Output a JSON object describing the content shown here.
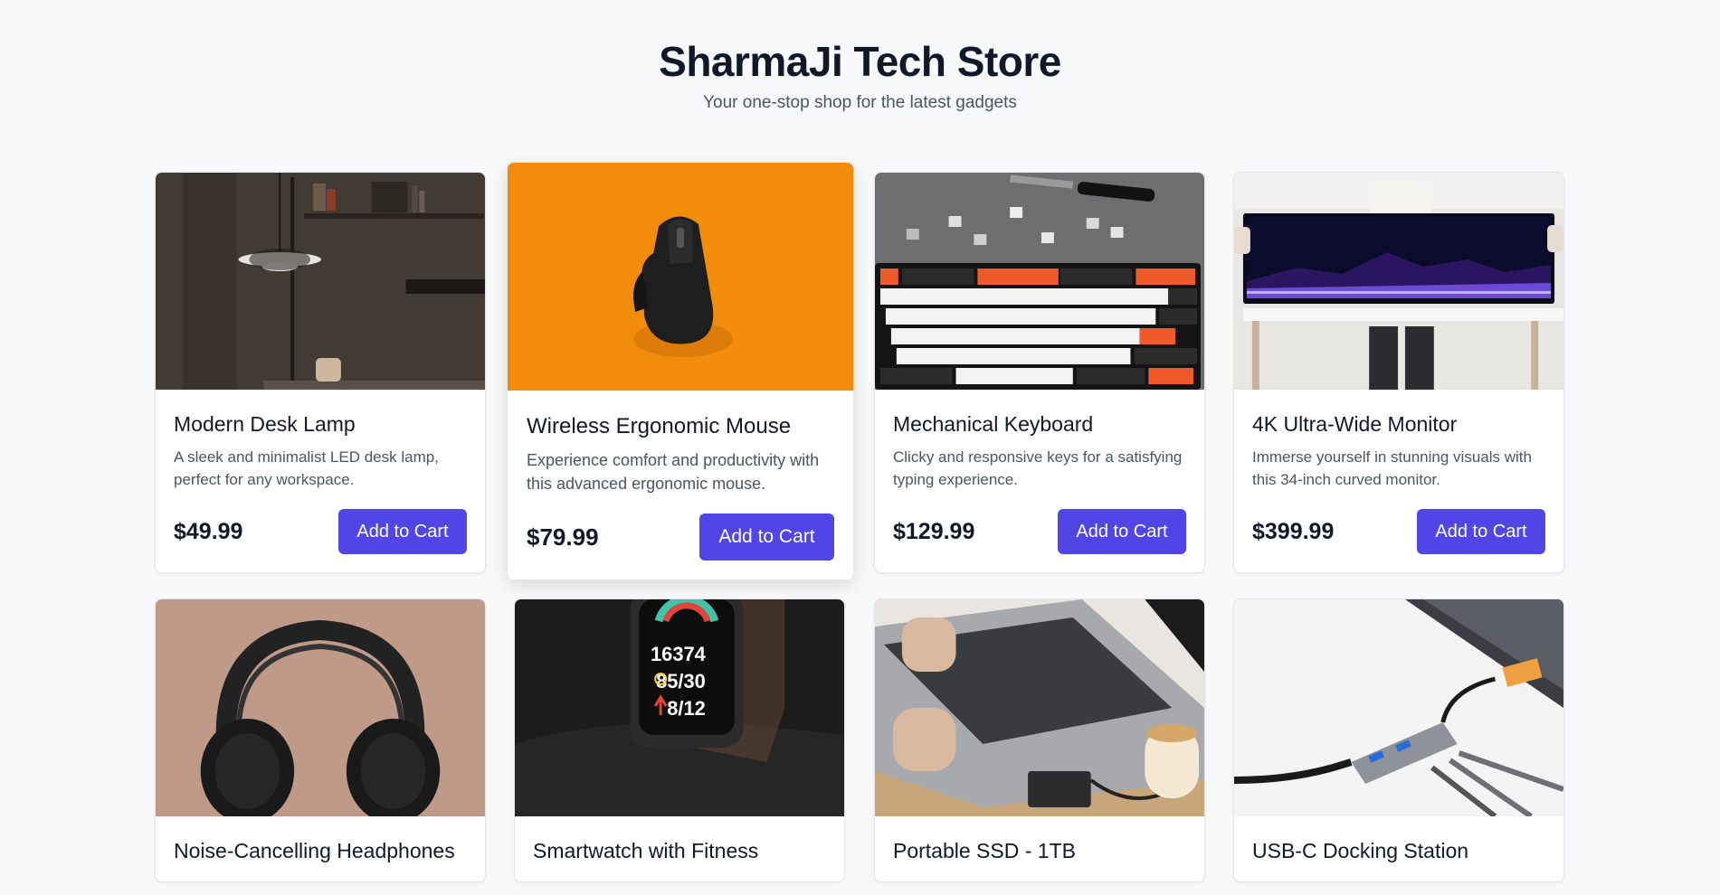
{
  "store": {
    "title": "SharmaJi Tech Store",
    "tagline": "Your one-stop shop for the latest gadgets"
  },
  "theme": {
    "accent": "#4f46e5",
    "background": "#f8f9fb"
  },
  "products": [
    {
      "title": "Modern Desk Lamp",
      "description": "A sleek and minimalist LED desk lamp, perfect for any workspace.",
      "price": "$49.99",
      "cta": "Add to Cart"
    },
    {
      "title": "Wireless Ergonomic Mouse",
      "description": "Experience comfort and productivity with this advanced ergonomic mouse.",
      "price": "$79.99",
      "cta": "Add to Cart"
    },
    {
      "title": "Mechanical Keyboard",
      "description": "Clicky and responsive keys for a satisfying typing experience.",
      "price": "$129.99",
      "cta": "Add to Cart"
    },
    {
      "title": "4K Ultra-Wide Monitor",
      "description": "Immerse yourself in stunning visuals with this 34-inch curved monitor.",
      "price": "$399.99",
      "cta": "Add to Cart"
    },
    {
      "title": "Noise-Cancelling Headphones"
    },
    {
      "title": "Smartwatch with Fitness",
      "watch_readout": [
        "16374",
        "85/30",
        "8/12"
      ]
    },
    {
      "title": "Portable SSD - 1TB"
    },
    {
      "title": "USB-C Docking Station"
    }
  ]
}
